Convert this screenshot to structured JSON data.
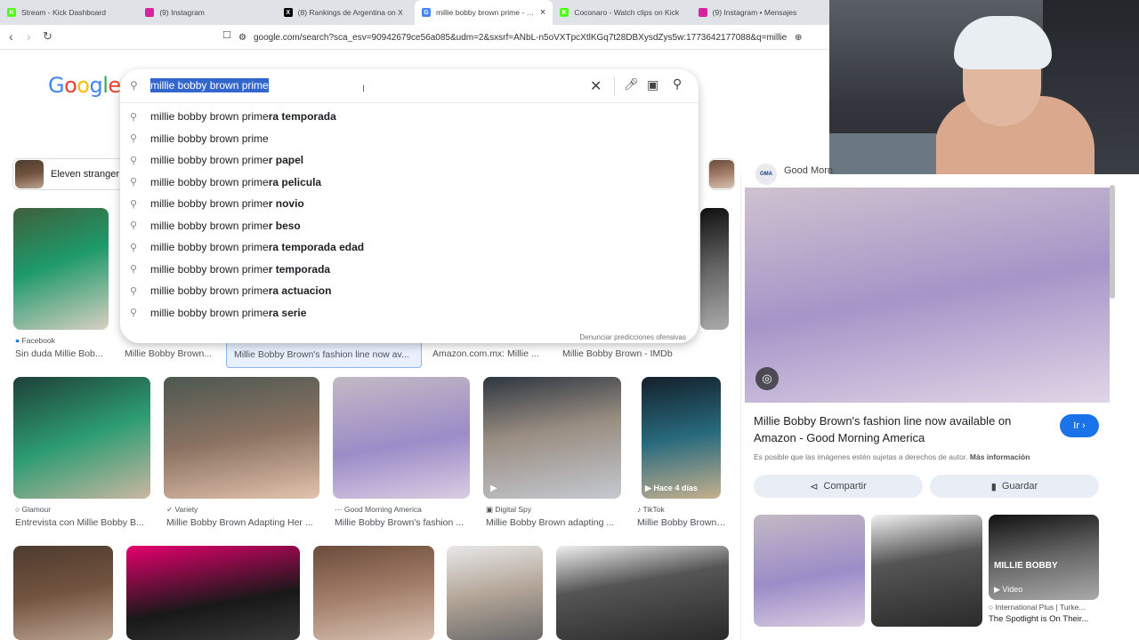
{
  "tabs": [
    {
      "label": "Stream - Kick Dashboard",
      "fav": "K",
      "color": "#53fc18"
    },
    {
      "label": "(9) Instagram",
      "fav": "",
      "color": "#d6249f"
    },
    {
      "label": "(8) Rankings de Argentina on X",
      "fav": "X",
      "color": "#000000"
    },
    {
      "label": "millie bobby brown prime - Bus",
      "fav": "G",
      "color": "#4285f4"
    },
    {
      "label": "Coconaro - Watch clips on Kick",
      "fav": "K",
      "color": "#53fc18"
    },
    {
      "label": "(9) Instagram • Mensajes",
      "fav": "",
      "color": "#d6249f"
    }
  ],
  "url": "google.com/search?sca_esv=90942679ce56a085&udm=2&sxsrf=ANbL-n5oVXTpcXtlKGq7t28DBXysdZys5w:1773642177088&q=millie+bobby+...",
  "logo": "Google",
  "search": {
    "query": "millie bobby brown prime",
    "suggestions": [
      {
        "base": "millie bobby brown prime",
        "bold": "ra temporada"
      },
      {
        "base": "millie bobby brown prime",
        "bold": ""
      },
      {
        "base": "millie bobby brown prime",
        "bold": "r papel"
      },
      {
        "base": "millie bobby brown prime",
        "bold": "ra pelicula"
      },
      {
        "base": "millie bobby brown prime",
        "bold": "r novio"
      },
      {
        "base": "millie bobby brown prime",
        "bold": "r beso"
      },
      {
        "base": "millie bobby brown prime",
        "bold": "ra temporada edad"
      },
      {
        "base": "millie bobby brown prime",
        "bold": "r temporada"
      },
      {
        "base": "millie bobby brown prime",
        "bold": "ra actuacion"
      },
      {
        "base": "millie bobby brown prime",
        "bold": "ra serie"
      }
    ],
    "report": "Denunciar predicciones ofensivas"
  },
  "chips": [
    "Eleven stranger"
  ],
  "row1": [
    {
      "source": "Facebook",
      "caption": "Sin duda Millie Bob..."
    },
    {
      "source": "",
      "caption": "Millie Bobby Brown..."
    },
    {
      "source": "",
      "caption": "Millie Bobby Brown's fashion line now av..."
    },
    {
      "source": "",
      "caption": "Amazon.com.mx: Millie ..."
    },
    {
      "source": "",
      "caption": "Millie Bobby Brown - IMDb"
    }
  ],
  "row2": [
    {
      "source": "Glamour",
      "caption": "Entrevista con Millie Bobby B..."
    },
    {
      "source": "Variety",
      "caption": "Millie Bobby Brown Adapting Her ..."
    },
    {
      "source": "Good Morning America",
      "caption": "Millie Bobby Brown's fashion ..."
    },
    {
      "source": "Digital Spy",
      "caption": "Millie Bobby Brown adapting ..."
    },
    {
      "source": "TikTok",
      "caption": "Millie Bobby Brown ..."
    }
  ],
  "tiktok_badge": "Hace 4 días",
  "panel": {
    "site": "Good Morn",
    "title": "Millie Bobby Brown's fashion line now available on Amazon - Good Morning America",
    "go": "Ir",
    "notice": "Es posible que las imágenes estén sujetas a derechos de autor.",
    "more": "Más información",
    "share": "Compartir",
    "save": "Guardar",
    "thumb_overlay": "MILLIE BOBBY",
    "thumb_badge": "Video",
    "thumb_source": "International Plus | Turke...",
    "thumb_caption": "The Spotlight is On Their..."
  }
}
